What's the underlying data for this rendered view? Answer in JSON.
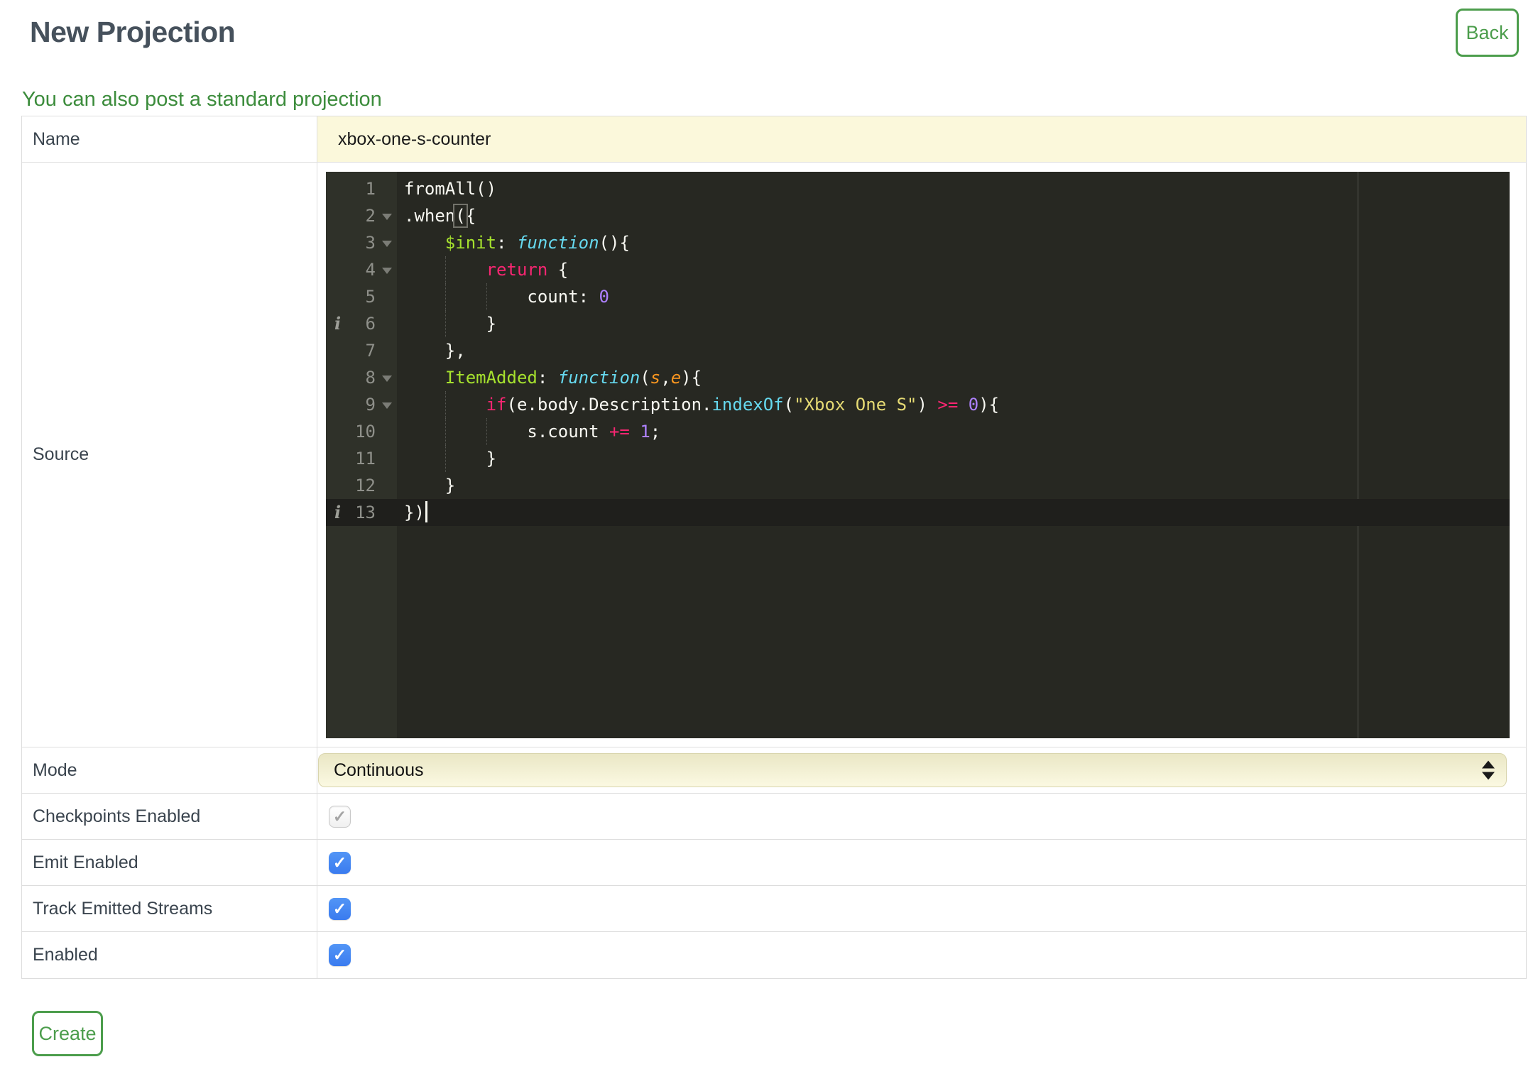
{
  "page": {
    "title": "New Projection",
    "subtitle_link": "You can also post a standard projection",
    "back_button": "Back",
    "create_button": "Create"
  },
  "theme": {
    "green": "#4C9D4C",
    "link-green": "#3C8C3C",
    "heading": "#46515C",
    "label": "#3A444E",
    "table-border": "#DDDDDD",
    "input-yellow": "#FBF8DB",
    "select-yellow-top": "#EAE7C5",
    "select-yellow-bottom": "#FBF9E2",
    "checkbox-blue-top": "#5295F6",
    "checkbox-blue-bottom": "#3A7BEF",
    "editor-bg": "#272822",
    "gutter-bg": "#2F3129",
    "gutter-text": "#8F908A",
    "code-text": "#F8F8F2",
    "tok-keyword": "#F92672",
    "tok-storage": "#66D9EF",
    "tok-support": "#66D9EF",
    "tok-entity": "#A6E22E",
    "tok-constant": "#AE81FF",
    "tok-string": "#E6DB74",
    "tok-param": "#FD971F",
    "active-line": "#1F1F1C",
    "print-margin": "#555651"
  },
  "form": {
    "name": {
      "label": "Name",
      "value": "xbox-one-s-counter"
    },
    "source": {
      "label": "Source"
    },
    "mode": {
      "label": "Mode",
      "value": "Continuous",
      "icon": "updown-arrows-icon"
    },
    "checkboxes": [
      {
        "label": "Checkpoints Enabled",
        "state": "checked-disabled",
        "icon": "check-icon",
        "glyph": "✓"
      },
      {
        "label": "Emit Enabled",
        "state": "checked",
        "icon": "check-icon",
        "glyph": "✓"
      },
      {
        "label": "Track Emitted Streams",
        "state": "checked",
        "icon": "check-icon",
        "glyph": "✓"
      },
      {
        "label": "Enabled",
        "state": "checked",
        "icon": "check-icon",
        "glyph": "✓"
      }
    ]
  },
  "editor": {
    "language": "javascript",
    "lines": [
      {
        "num": 1,
        "segments": [
          {
            "t": "fromAll()"
          }
        ]
      },
      {
        "num": 2,
        "fold": true,
        "segments": [
          {
            "t": ".when"
          },
          {
            "t": "(",
            "hl": true
          },
          {
            "t": "{"
          }
        ]
      },
      {
        "num": 3,
        "fold": true,
        "segments": [
          {
            "t": "    "
          },
          {
            "t": "$init",
            "c": "entity"
          },
          {
            "t": ": "
          },
          {
            "t": "function",
            "c": "storage"
          },
          {
            "t": "(){"
          }
        ]
      },
      {
        "num": 4,
        "fold": true,
        "guides": 1,
        "segments": [
          {
            "t": "        "
          },
          {
            "t": "return",
            "c": "keyword"
          },
          {
            "t": " {"
          }
        ]
      },
      {
        "num": 5,
        "guides": 2,
        "segments": [
          {
            "t": "            count: "
          },
          {
            "t": "0",
            "c": "constant"
          }
        ]
      },
      {
        "num": 6,
        "info": true,
        "guides": 1,
        "segments": [
          {
            "t": "        }"
          }
        ]
      },
      {
        "num": 7,
        "segments": [
          {
            "t": "    },"
          }
        ]
      },
      {
        "num": 8,
        "fold": true,
        "segments": [
          {
            "t": "    "
          },
          {
            "t": "ItemAdded",
            "c": "entity"
          },
          {
            "t": ": "
          },
          {
            "t": "function",
            "c": "storage"
          },
          {
            "t": "("
          },
          {
            "t": "s",
            "c": "param"
          },
          {
            "t": ","
          },
          {
            "t": "e",
            "c": "param"
          },
          {
            "t": "){"
          }
        ]
      },
      {
        "num": 9,
        "fold": true,
        "guides": 1,
        "segments": [
          {
            "t": "        "
          },
          {
            "t": "if",
            "c": "keyword"
          },
          {
            "t": "(e.body.Description."
          },
          {
            "t": "indexOf",
            "c": "support"
          },
          {
            "t": "("
          },
          {
            "t": "\"Xbox One S\"",
            "c": "string"
          },
          {
            "t": ") "
          },
          {
            "t": ">=",
            "c": "keyword"
          },
          {
            "t": " "
          },
          {
            "t": "0",
            "c": "constant"
          },
          {
            "t": "){"
          }
        ]
      },
      {
        "num": 10,
        "guides": 2,
        "segments": [
          {
            "t": "            s.count "
          },
          {
            "t": "+=",
            "c": "keyword"
          },
          {
            "t": " "
          },
          {
            "t": "1",
            "c": "constant"
          },
          {
            "t": ";"
          }
        ]
      },
      {
        "num": 11,
        "guides": 1,
        "segments": [
          {
            "t": "        }"
          }
        ]
      },
      {
        "num": 12,
        "segments": [
          {
            "t": "    }"
          }
        ]
      },
      {
        "num": 13,
        "info": true,
        "active": true,
        "cursor": true,
        "segments": [
          {
            "t": "})"
          }
        ]
      }
    ]
  }
}
